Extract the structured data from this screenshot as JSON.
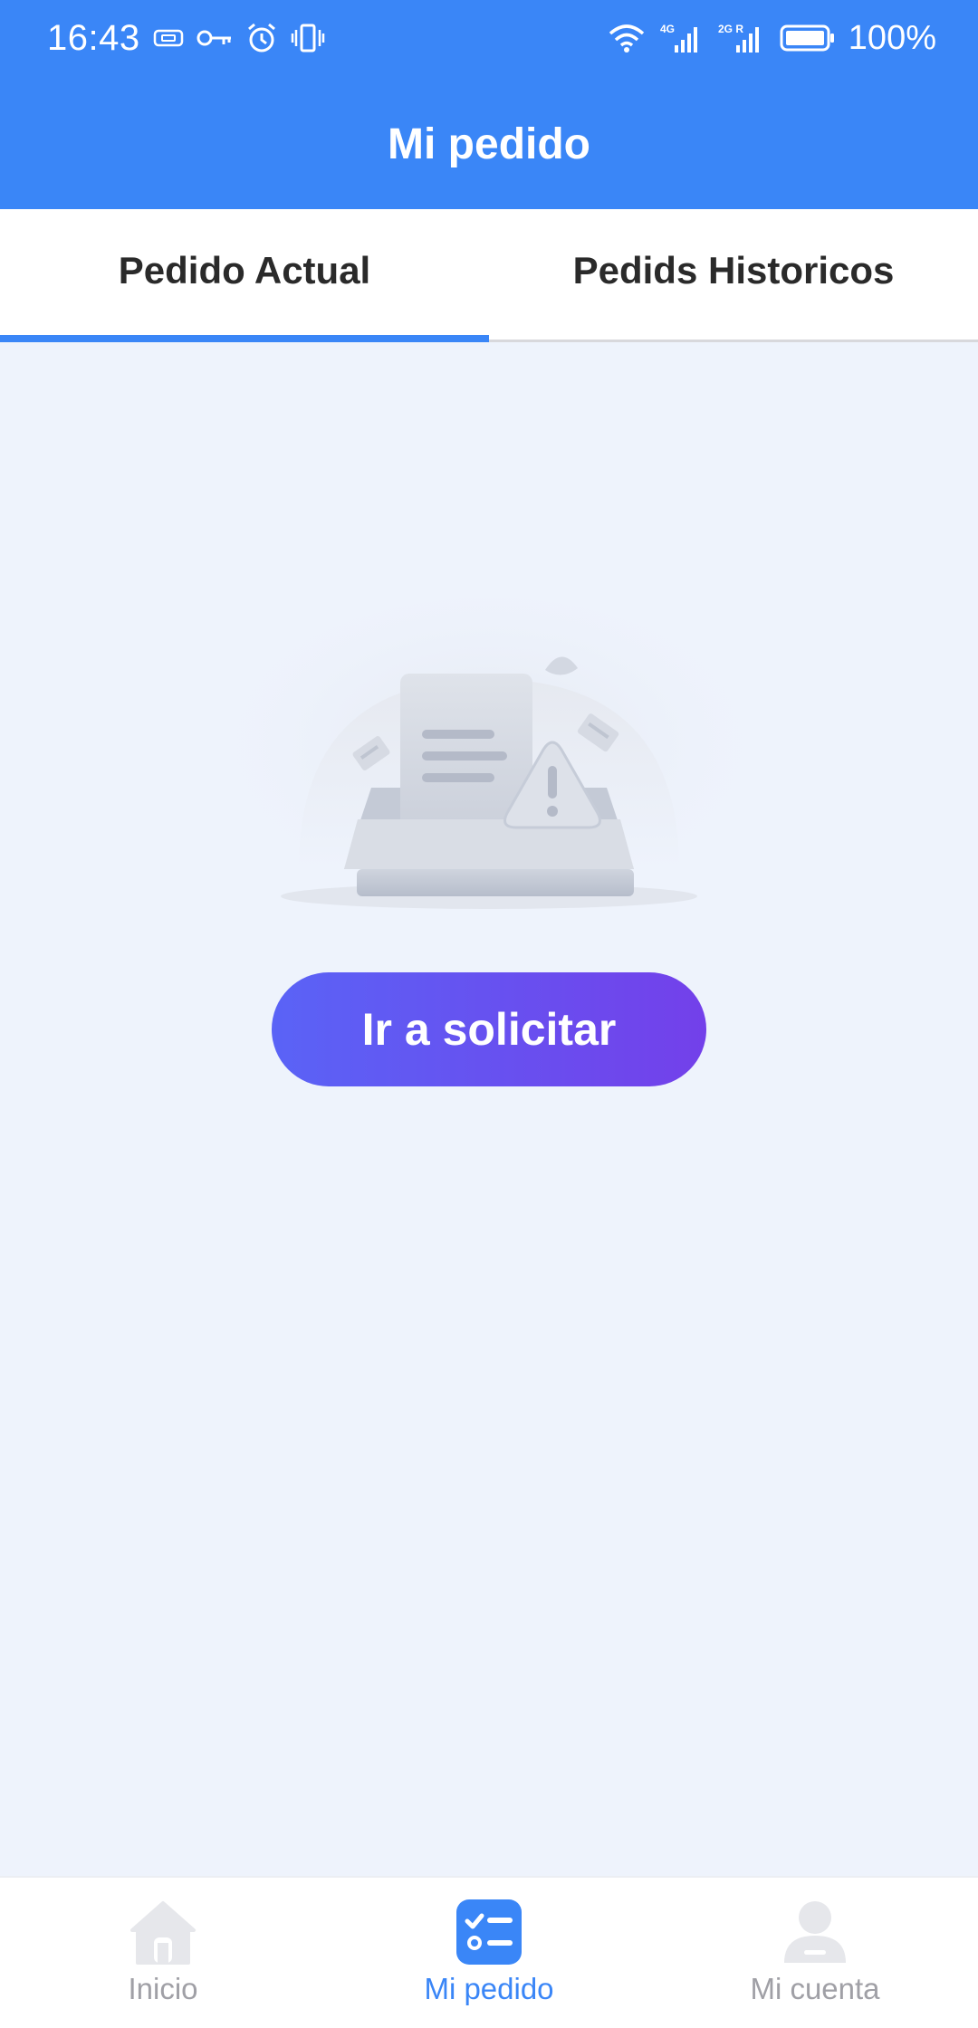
{
  "status_bar": {
    "time": "16:43",
    "battery": "100%",
    "icons": [
      "sim-card-icon",
      "key-icon",
      "alarm-icon",
      "vibrate-icon",
      "wifi-icon",
      "signal-4g-icon",
      "signal-2g-icon",
      "battery-icon"
    ],
    "signal_labels": [
      "4G",
      "2G R"
    ]
  },
  "header": {
    "title": "Mi pedido",
    "background_color": "#3a86f7"
  },
  "tabs": [
    {
      "label": "Pedido Actual",
      "active": true
    },
    {
      "label": "Pedids Historicos",
      "active": false
    }
  ],
  "main": {
    "illustration": "empty-inbox-warning-illustration",
    "cta_label": "Ir a solicitar",
    "cta_gradient": [
      "#5a63f6",
      "#7340ea"
    ]
  },
  "bottom_nav": {
    "items": [
      {
        "label": "Inicio",
        "icon": "home-icon",
        "active": false
      },
      {
        "label": "Mi pedido",
        "icon": "order-list-icon",
        "active": true
      },
      {
        "label": "Mi cuenta",
        "icon": "user-icon",
        "active": false
      }
    ],
    "active_color": "#3a86f7",
    "inactive_color": "#a0a0a6"
  }
}
